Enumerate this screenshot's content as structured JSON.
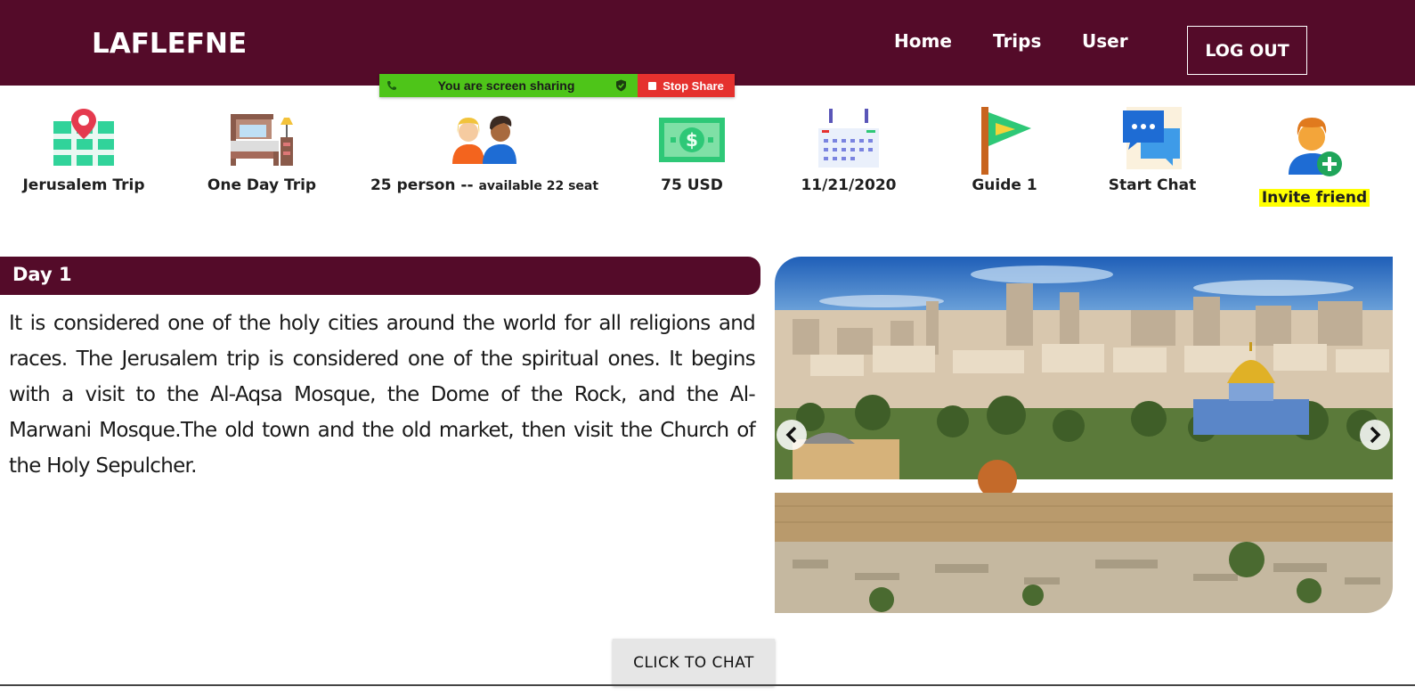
{
  "header": {
    "brand": "LAFLEFNE",
    "nav": {
      "home": "Home",
      "trips": "Trips",
      "user": "User"
    },
    "logout": "LOG OUT"
  },
  "screen_share": {
    "status": "You are screen sharing",
    "stop": "Stop Share"
  },
  "info": {
    "trip_name": "Jerusalem Trip",
    "duration": "One Day Trip",
    "capacity": "25 person",
    "capacity_separator": " -- ",
    "availability": "available 22 seat",
    "price": "75 USD",
    "date": "11/21/2020",
    "guide": "Guide 1",
    "chat": "Start Chat",
    "invite": "Invite friend"
  },
  "day": {
    "title": "Day 1",
    "description": "It is considered one of the holy cities around the world for all religions and races. The Jerusalem trip is considered one of the spiritual ones. It begins with a visit to the Al-Aqsa Mosque, the Dome of the Rock, and the Al-Marwani Mosque.The old town and the old market, then visit the Church of the Holy Sepulcher."
  },
  "chat_button": "CLICK TO CHAT",
  "colors": {
    "primary": "#540b29",
    "share_green": "#4ec519",
    "share_red": "#e5312e",
    "highlight": "#ffff00"
  },
  "icons": [
    "map-pin-icon",
    "bed-icon",
    "people-icon",
    "money-icon",
    "calendar-icon",
    "flag-icon",
    "chat-bubbles-icon",
    "add-user-icon",
    "chevron-left-icon",
    "chevron-right-icon",
    "phone-icon",
    "shield-check-icon"
  ]
}
